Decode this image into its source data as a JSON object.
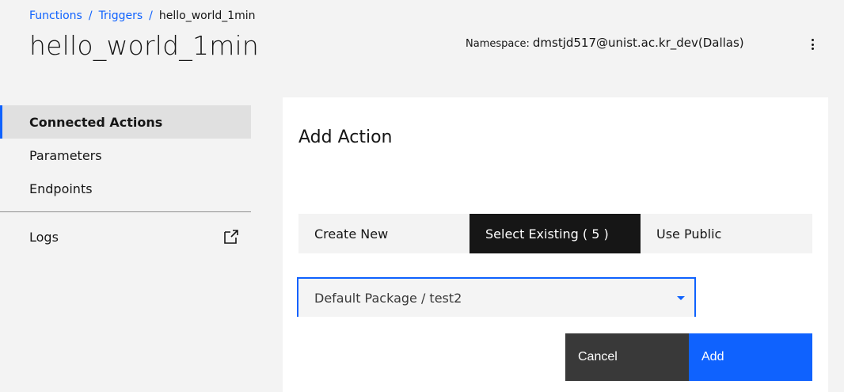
{
  "breadcrumb": {
    "items": [
      "Functions",
      "Triggers"
    ],
    "separator": "/",
    "current": "hello_world_1min"
  },
  "header": {
    "title": "hello_world_1min",
    "namespace_label": "Namespace:",
    "namespace_value": "dmstjd517@unist.ac.kr_dev(Dallas)",
    "overflow_icon": "overflow-menu-vertical-icon"
  },
  "sidenav": {
    "items": [
      {
        "label": "Connected Actions",
        "active": true
      },
      {
        "label": "Parameters",
        "active": false
      },
      {
        "label": "Endpoints",
        "active": false
      }
    ],
    "logs": {
      "label": "Logs",
      "icon": "external-link-icon"
    }
  },
  "panel": {
    "title": "Add Action",
    "tabs": [
      {
        "label": "Create New",
        "selected": false
      },
      {
        "label": "Select Existing ( 5 )",
        "selected": true
      },
      {
        "label": "Use Public",
        "selected": false
      }
    ],
    "select": {
      "value": "Default Package / test2",
      "icon": "caret-down-icon"
    },
    "buttons": {
      "cancel": "Cancel",
      "add": "Add"
    }
  },
  "colors": {
    "accent": "#0f62fe",
    "background": "#f3f3f3",
    "tab_selected": "#161616",
    "cancel": "#393939"
  }
}
